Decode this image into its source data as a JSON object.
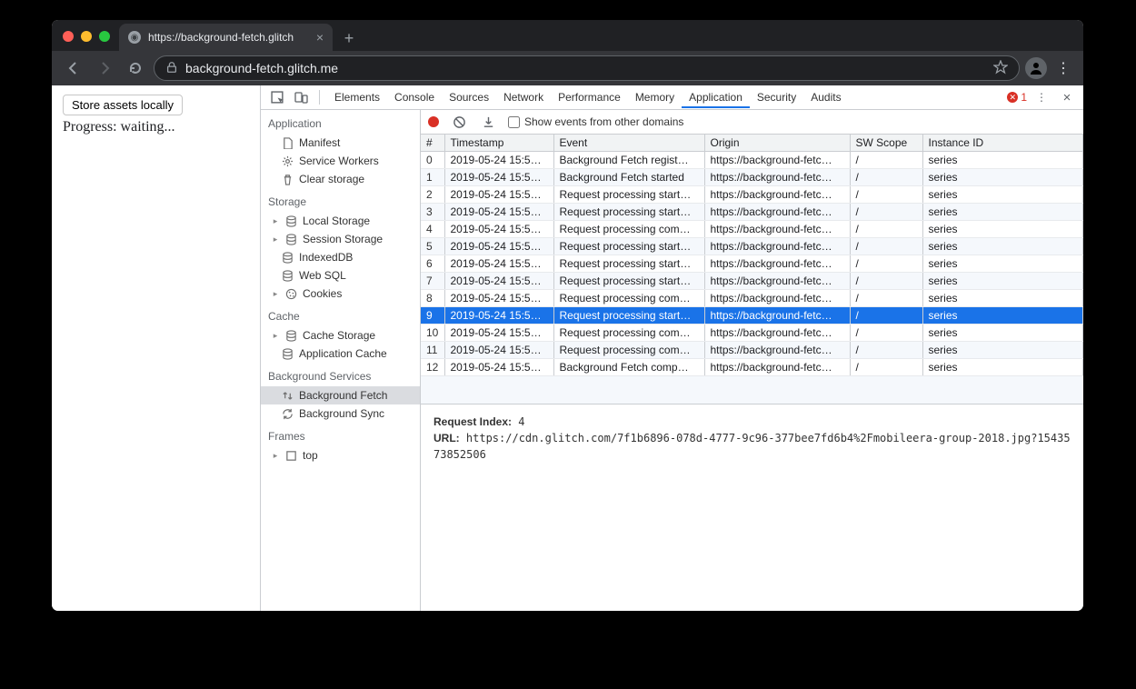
{
  "browser": {
    "tab_title": "https://background-fetch.glitch",
    "url_display": "background-fetch.glitch.me",
    "new_tab": "+"
  },
  "page": {
    "button_label": "Store assets locally",
    "progress_label": "Progress: waiting..."
  },
  "devtools": {
    "tabs": [
      "Elements",
      "Console",
      "Sources",
      "Network",
      "Performance",
      "Memory",
      "Application",
      "Security",
      "Audits"
    ],
    "active_tab": "Application",
    "error_count": "1",
    "sidebar": {
      "sections": [
        {
          "title": "Application",
          "items": [
            {
              "label": "Manifest",
              "icon": "file",
              "expandable": false
            },
            {
              "label": "Service Workers",
              "icon": "gear",
              "expandable": false
            },
            {
              "label": "Clear storage",
              "icon": "trash",
              "expandable": false
            }
          ]
        },
        {
          "title": "Storage",
          "items": [
            {
              "label": "Local Storage",
              "icon": "db",
              "expandable": true
            },
            {
              "label": "Session Storage",
              "icon": "db",
              "expandable": true
            },
            {
              "label": "IndexedDB",
              "icon": "db",
              "expandable": false
            },
            {
              "label": "Web SQL",
              "icon": "db",
              "expandable": false
            },
            {
              "label": "Cookies",
              "icon": "cookie",
              "expandable": true
            }
          ]
        },
        {
          "title": "Cache",
          "items": [
            {
              "label": "Cache Storage",
              "icon": "db",
              "expandable": true
            },
            {
              "label": "Application Cache",
              "icon": "db",
              "expandable": false
            }
          ]
        },
        {
          "title": "Background Services",
          "items": [
            {
              "label": "Background Fetch",
              "icon": "updown",
              "expandable": false,
              "selected": true
            },
            {
              "label": "Background Sync",
              "icon": "sync",
              "expandable": false
            }
          ]
        },
        {
          "title": "Frames",
          "items": [
            {
              "label": "top",
              "icon": "frame",
              "expandable": true
            }
          ]
        }
      ]
    },
    "toolbar": {
      "show_other_domains_label": "Show events from other domains"
    },
    "columns": [
      "#",
      "Timestamp",
      "Event",
      "Origin",
      "SW Scope",
      "Instance ID"
    ],
    "rows": [
      {
        "num": "0",
        "ts": "2019-05-24 15:5…",
        "event": "Background Fetch regist…",
        "origin": "https://background-fetc…",
        "scope": "/",
        "id": "series"
      },
      {
        "num": "1",
        "ts": "2019-05-24 15:5…",
        "event": "Background Fetch started",
        "origin": "https://background-fetc…",
        "scope": "/",
        "id": "series"
      },
      {
        "num": "2",
        "ts": "2019-05-24 15:5…",
        "event": "Request processing start…",
        "origin": "https://background-fetc…",
        "scope": "/",
        "id": "series"
      },
      {
        "num": "3",
        "ts": "2019-05-24 15:5…",
        "event": "Request processing start…",
        "origin": "https://background-fetc…",
        "scope": "/",
        "id": "series"
      },
      {
        "num": "4",
        "ts": "2019-05-24 15:5…",
        "event": "Request processing com…",
        "origin": "https://background-fetc…",
        "scope": "/",
        "id": "series"
      },
      {
        "num": "5",
        "ts": "2019-05-24 15:5…",
        "event": "Request processing start…",
        "origin": "https://background-fetc…",
        "scope": "/",
        "id": "series"
      },
      {
        "num": "6",
        "ts": "2019-05-24 15:5…",
        "event": "Request processing start…",
        "origin": "https://background-fetc…",
        "scope": "/",
        "id": "series"
      },
      {
        "num": "7",
        "ts": "2019-05-24 15:5…",
        "event": "Request processing start…",
        "origin": "https://background-fetc…",
        "scope": "/",
        "id": "series"
      },
      {
        "num": "8",
        "ts": "2019-05-24 15:5…",
        "event": "Request processing com…",
        "origin": "https://background-fetc…",
        "scope": "/",
        "id": "series"
      },
      {
        "num": "9",
        "ts": "2019-05-24 15:5…",
        "event": "Request processing start…",
        "origin": "https://background-fetc…",
        "scope": "/",
        "id": "series",
        "selected": true
      },
      {
        "num": "10",
        "ts": "2019-05-24 15:5…",
        "event": "Request processing com…",
        "origin": "https://background-fetc…",
        "scope": "/",
        "id": "series"
      },
      {
        "num": "11",
        "ts": "2019-05-24 15:5…",
        "event": "Request processing com…",
        "origin": "https://background-fetc…",
        "scope": "/",
        "id": "series"
      },
      {
        "num": "12",
        "ts": "2019-05-24 15:5…",
        "event": "Background Fetch comp…",
        "origin": "https://background-fetc…",
        "scope": "/",
        "id": "series"
      }
    ],
    "details": {
      "request_index_label": "Request Index:",
      "request_index_value": "4",
      "url_label": "URL:",
      "url_value": "https://cdn.glitch.com/7f1b6896-078d-4777-9c96-377bee7fd6b4%2Fmobileera-group-2018.jpg?1543573852506"
    }
  }
}
